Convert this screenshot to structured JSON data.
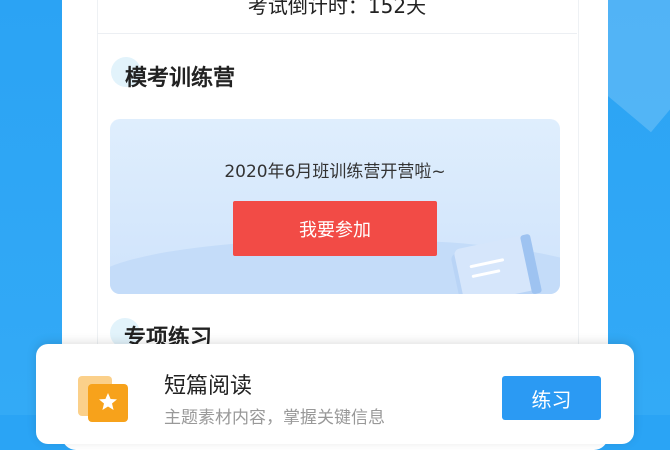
{
  "countdown": {
    "text": "考试倒计时：152天"
  },
  "mock_camp": {
    "title": "模考训练营",
    "banner_text": "2020年6月班训练营开营啦~",
    "join_label": "我要参加"
  },
  "special_practice": {
    "title": "专项练习"
  },
  "practice_item": {
    "title": "短篇阅读",
    "subtitle": "主题素材内容，掌握关键信息",
    "button_label": "练习"
  },
  "colors": {
    "background": "#2ba3f4",
    "join_button": "#f24b46",
    "practice_button": "#2b9af3",
    "icon_orange": "#f7a21b"
  },
  "icons": [
    "book-illustration-icon",
    "star-document-icon"
  ]
}
